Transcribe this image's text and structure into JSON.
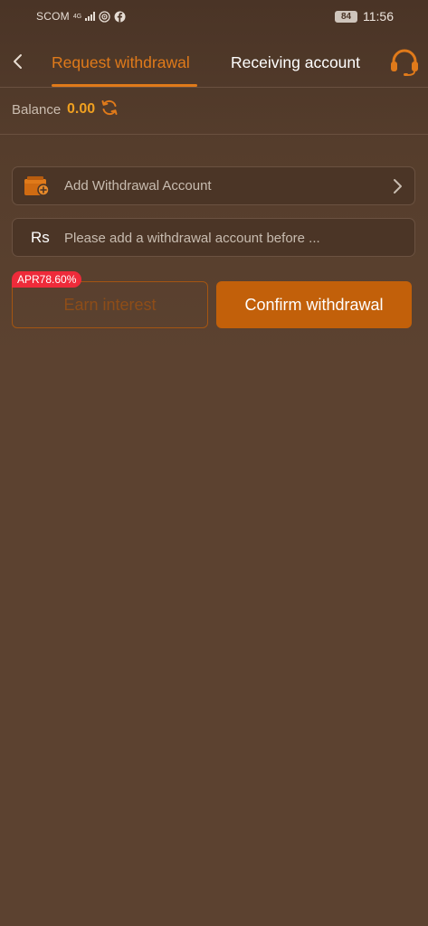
{
  "status_bar": {
    "carrier": "SCOM",
    "network": "4G",
    "battery": "84",
    "time": "11:56",
    "icons": [
      "signal-icon",
      "hotspot-icon",
      "facebook-icon"
    ]
  },
  "header": {
    "back_icon": "chevron-left-icon",
    "tabs": [
      {
        "label": "Request withdrawal",
        "active": true
      },
      {
        "label": "Receiving account",
        "active": false
      }
    ],
    "support_icon": "headset-icon"
  },
  "balance": {
    "label": "Balance",
    "value": "0.00",
    "refresh_icon": "refresh-icon"
  },
  "account_field": {
    "icon": "wallet-icon",
    "label": "Add Withdrawal Account",
    "chevron_icon": "chevron-right-icon"
  },
  "amount_field": {
    "currency": "Rs",
    "value": "",
    "placeholder": "Please add a withdrawal account before ..."
  },
  "actions": {
    "apr_badge": "APR78.60%",
    "earn_label": "Earn interest",
    "confirm_label": "Confirm withdrawal"
  },
  "colors": {
    "accent": "#e07a1a",
    "background": "#5c4230",
    "confirm_button": "#c2600a",
    "badge": "#ee2b3a",
    "balance_value": "#f0a020"
  }
}
